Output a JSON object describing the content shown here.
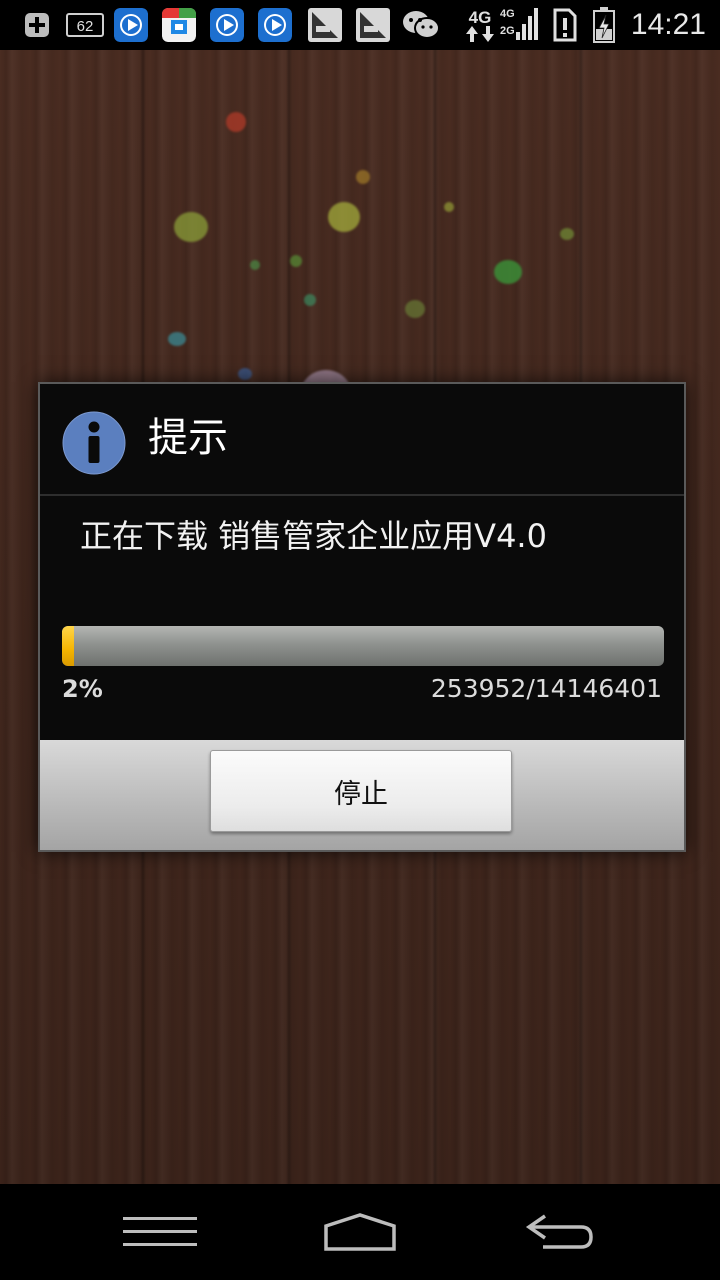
{
  "status_bar": {
    "notification_count": "62",
    "network_label": "4G",
    "network_secondary": "4G",
    "network_tertiary": "2G",
    "time": "14:21",
    "icons": [
      "add-icon",
      "notification-count-icon",
      "video-app-icon",
      "store-app-icon",
      "video-app-icon",
      "video-app-icon",
      "usb-debug-icon",
      "usb-debug-icon",
      "wechat-icon",
      "data-arrows-icon",
      "signal-icon",
      "sim-alert-icon",
      "battery-charging-icon"
    ]
  },
  "dialog": {
    "icon": "info-icon",
    "title": "提示",
    "message": "正在下载 销售管家企业应用V4.0",
    "progress": {
      "fraction": 0.02,
      "percent_label": "2%",
      "count_label": "253952/14146401"
    },
    "stop_button_label": "停止"
  },
  "nav_bar": {
    "icons": [
      "menu-icon",
      "home-icon",
      "back-icon"
    ]
  },
  "colors": {
    "progress_fill": "#f5b400",
    "info_icon_bg": "#5b7fbf"
  }
}
